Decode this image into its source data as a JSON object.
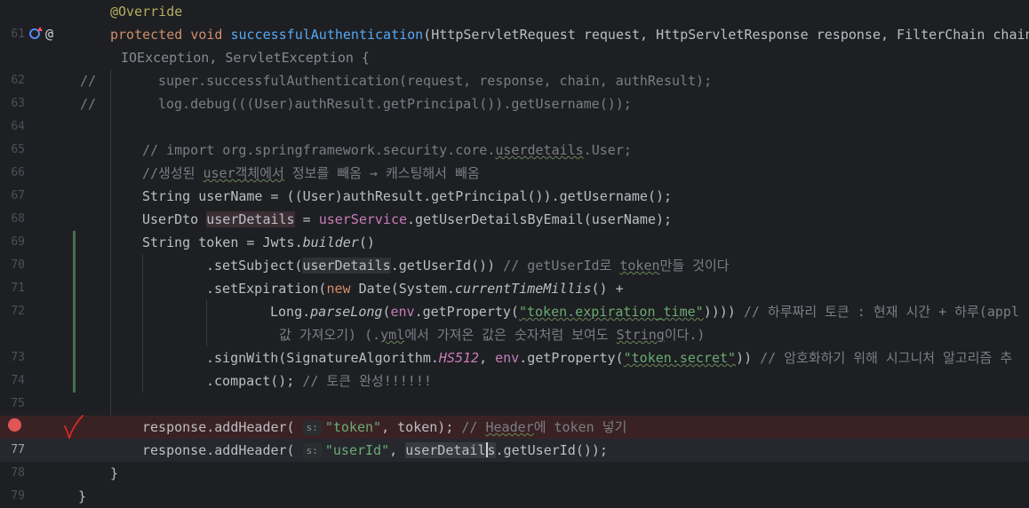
{
  "gutter": {
    "line_numbers": [
      "",
      "61",
      "",
      "62",
      "63",
      "64",
      "65",
      "66",
      "67",
      "68",
      "69",
      "70",
      "71",
      "72",
      "",
      "73",
      "74",
      "75",
      "",
      "77",
      "78",
      "79"
    ],
    "at_symbol": "@"
  },
  "code": {
    "l1": {
      "annotation": "@Override"
    },
    "l2": {
      "k1": "protected",
      "k2": "void",
      "fn": "successfulAuthentication",
      "rest": "(HttpServletRequest request, HttpServletResponse response, FilterChain chain"
    },
    "l3": {
      "rest": "IOException, ServletException {"
    },
    "l4": {
      "slashes": "//",
      "body": "super.successfulAuthentication(request, response, chain, authResult);"
    },
    "l5": {
      "slashes": "//",
      "body": "log.debug(((User)authResult.getPrincipal()).getUsername());"
    },
    "l6": {
      "a": "// import org.springframework.security.core.",
      "b": "userdetails",
      "c": ".User;"
    },
    "l7": {
      "a": "//생성된 ",
      "b": "user객체에서",
      "c": " 정보를 빼옴 → 캐스팅해서 빼옴"
    },
    "l8": {
      "text": "String userName = ((User)authResult.getPrincipal()).getUsername();"
    },
    "l9": {
      "a": "UserDto ",
      "b": "userDetails",
      "c": " = ",
      "d": "userService",
      "e": ".getUserDetailsByEmail(userName);"
    },
    "l10": {
      "a": "String token = Jwts.",
      "b": "builder",
      "c": "()"
    },
    "l11": {
      "a": ".setSubject(",
      "b": "userDetails",
      "c": ".getUserId()) ",
      "d": "// getUserId로 ",
      "e": "token",
      "f": "만들 것이다"
    },
    "l12": {
      "a": ".setExpiration(",
      "k": "new",
      "b": " Date(System.",
      "c": "currentTimeMillis",
      "d": "() +"
    },
    "l13": {
      "a": "Long.",
      "b": "parseLong",
      "c": "(",
      "d": "env",
      "e": ".getProperty(",
      "f": "\"token.expiration_time\"",
      "g": ")))) ",
      "h": "// 하루짜리 토큰 : 현재 시간 + 하루(appl"
    },
    "l14": {
      "a": "값 가져오기) (.",
      "b": "yml",
      "c": "에서 가져온 값은 숫자처럼 보여도 ",
      "d": "String",
      "e": "이다.)"
    },
    "l15": {
      "a": ".signWith(SignatureAlgorithm.",
      "b": "HS512",
      "c": ", ",
      "d": "env",
      "e": ".getProperty(",
      "f": "\"token.secret\"",
      "g": ")) ",
      "h": "// 암호화하기 위해 시그니처 알고리즘 추"
    },
    "l16": {
      "a": ".compact(); ",
      "b": "// 토큰 완성!!!!!!"
    },
    "l18": {
      "a": "response.addHeader( ",
      "hint": "s:",
      "s": "\"token\"",
      "b": ", token); ",
      "c": "// ",
      "d": "Header",
      "e": "에 token 넣기"
    },
    "l19": {
      "a": "response.addHeader( ",
      "hint": "s:",
      "s": "\"userId\"",
      "b": ", ",
      "c1": "userDetail",
      "c2": "s",
      "d": ".getUserId());"
    },
    "l20": {
      "text": "}"
    },
    "l21": {
      "text": "}"
    }
  },
  "colors": {
    "background": "#1e1f22",
    "keyword": "#cf8e6d",
    "function": "#56a8f5",
    "string": "#6aab73",
    "comment": "#7a7e85",
    "annotation": "#b3ae60",
    "field": "#c77dbb",
    "breakpoint": "#e05555"
  },
  "icons": [
    "implements-icon",
    "at-annotation-icon",
    "breakpoint-icon",
    "red-checkmark-icon"
  ]
}
